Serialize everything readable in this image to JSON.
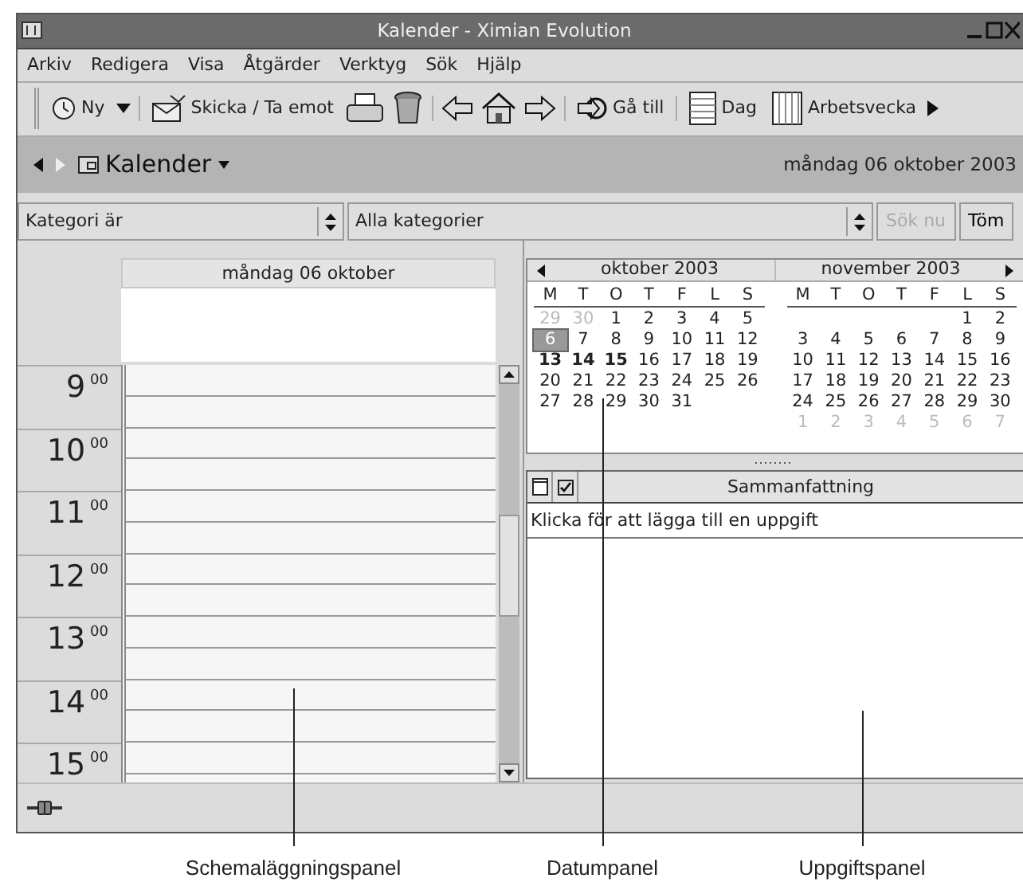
{
  "window": {
    "title": "Kalender - Ximian Evolution"
  },
  "menu": [
    "Arkiv",
    "Redigera",
    "Visa",
    "Åtgärder",
    "Verktyg",
    "Sök",
    "Hjälp"
  ],
  "toolbar": {
    "new": "Ny",
    "send_receive": "Skicka / Ta emot",
    "go_to": "Gå till",
    "day": "Dag",
    "work_week": "Arbetsvecka"
  },
  "folder_bar": {
    "title": "Kalender",
    "date": "måndag 06 oktober 2003"
  },
  "filter": {
    "field": "Kategori är",
    "value": "Alla kategorier",
    "buttons": [
      {
        "label": "Sök nu",
        "disabled": true
      },
      {
        "label": "Töm",
        "disabled": false
      }
    ]
  },
  "day_view": {
    "header": "måndag 06 oktober",
    "hours": [
      {
        "hour": "9",
        "minutes": "00"
      },
      {
        "hour": "10",
        "minutes": "00"
      },
      {
        "hour": "11",
        "minutes": "00"
      },
      {
        "hour": "12",
        "minutes": "00"
      },
      {
        "hour": "13",
        "minutes": "00"
      },
      {
        "hour": "14",
        "minutes": "00"
      },
      {
        "hour": "15",
        "minutes": "00"
      }
    ]
  },
  "date_navigator": {
    "months": [
      {
        "title": "oktober 2003",
        "weekdays": [
          "M",
          "T",
          "O",
          "T",
          "F",
          "L",
          "S"
        ],
        "weeks": [
          [
            {
              "day": "29",
              "selected": false,
              "other_month": true,
              "bold": false
            },
            {
              "day": "30",
              "selected": false,
              "other_month": true,
              "bold": false
            },
            {
              "day": "1",
              "selected": false,
              "other_month": false,
              "bold": false
            },
            {
              "day": "2",
              "selected": false,
              "other_month": false,
              "bold": false
            },
            {
              "day": "3",
              "selected": false,
              "other_month": false,
              "bold": false
            },
            {
              "day": "4",
              "selected": false,
              "other_month": false,
              "bold": false
            },
            {
              "day": "5",
              "selected": false,
              "other_month": false,
              "bold": false
            }
          ],
          [
            {
              "day": "6",
              "selected": true,
              "other_month": false,
              "bold": false
            },
            {
              "day": "7",
              "selected": false,
              "other_month": false,
              "bold": false
            },
            {
              "day": "8",
              "selected": false,
              "other_month": false,
              "bold": false
            },
            {
              "day": "9",
              "selected": false,
              "other_month": false,
              "bold": false
            },
            {
              "day": "10",
              "selected": false,
              "other_month": false,
              "bold": false
            },
            {
              "day": "11",
              "selected": false,
              "other_month": false,
              "bold": false
            },
            {
              "day": "12",
              "selected": false,
              "other_month": false,
              "bold": false
            }
          ],
          [
            {
              "day": "13",
              "selected": false,
              "other_month": false,
              "bold": true
            },
            {
              "day": "14",
              "selected": false,
              "other_month": false,
              "bold": true
            },
            {
              "day": "15",
              "selected": false,
              "other_month": false,
              "bold": true
            },
            {
              "day": "16",
              "selected": false,
              "other_month": false,
              "bold": false
            },
            {
              "day": "17",
              "selected": false,
              "other_month": false,
              "bold": false
            },
            {
              "day": "18",
              "selected": false,
              "other_month": false,
              "bold": false
            },
            {
              "day": "19",
              "selected": false,
              "other_month": false,
              "bold": false
            }
          ],
          [
            {
              "day": "20",
              "selected": false,
              "other_month": false,
              "bold": false
            },
            {
              "day": "21",
              "selected": false,
              "other_month": false,
              "bold": false
            },
            {
              "day": "22",
              "selected": false,
              "other_month": false,
              "bold": false
            },
            {
              "day": "23",
              "selected": false,
              "other_month": false,
              "bold": false
            },
            {
              "day": "24",
              "selected": false,
              "other_month": false,
              "bold": false
            },
            {
              "day": "25",
              "selected": false,
              "other_month": false,
              "bold": false
            },
            {
              "day": "26",
              "selected": false,
              "other_month": false,
              "bold": false
            }
          ],
          [
            {
              "day": "27",
              "selected": false,
              "other_month": false,
              "bold": false
            },
            {
              "day": "28",
              "selected": false,
              "other_month": false,
              "bold": false
            },
            {
              "day": "29",
              "selected": false,
              "other_month": false,
              "bold": false
            },
            {
              "day": "30",
              "selected": false,
              "other_month": false,
              "bold": false
            },
            {
              "day": "31",
              "selected": false,
              "other_month": false,
              "bold": false
            }
          ]
        ]
      },
      {
        "title": "november 2003",
        "weekdays": [
          "M",
          "T",
          "O",
          "T",
          "F",
          "L",
          "S"
        ],
        "weeks": [
          [
            {
              "day": "1",
              "selected": false,
              "other_month": false,
              "bold": false
            },
            {
              "day": "2",
              "selected": false,
              "other_month": false,
              "bold": false
            }
          ],
          [
            {
              "day": "3",
              "selected": false,
              "other_month": false,
              "bold": false
            },
            {
              "day": "4",
              "selected": false,
              "other_month": false,
              "bold": false
            },
            {
              "day": "5",
              "selected": false,
              "other_month": false,
              "bold": false
            },
            {
              "day": "6",
              "selected": false,
              "other_month": false,
              "bold": false
            },
            {
              "day": "7",
              "selected": false,
              "other_month": false,
              "bold": false
            },
            {
              "day": "8",
              "selected": false,
              "other_month": false,
              "bold": false
            },
            {
              "day": "9",
              "selected": false,
              "other_month": false,
              "bold": false
            }
          ],
          [
            {
              "day": "10",
              "selected": false,
              "other_month": false,
              "bold": false
            },
            {
              "day": "11",
              "selected": false,
              "other_month": false,
              "bold": false
            },
            {
              "day": "12",
              "selected": false,
              "other_month": false,
              "bold": false
            },
            {
              "day": "13",
              "selected": false,
              "other_month": false,
              "bold": false
            },
            {
              "day": "14",
              "selected": false,
              "other_month": false,
              "bold": false
            },
            {
              "day": "15",
              "selected": false,
              "other_month": false,
              "bold": false
            },
            {
              "day": "16",
              "selected": false,
              "other_month": false,
              "bold": false
            }
          ],
          [
            {
              "day": "17",
              "selected": false,
              "other_month": false,
              "bold": false
            },
            {
              "day": "18",
              "selected": false,
              "other_month": false,
              "bold": false
            },
            {
              "day": "19",
              "selected": false,
              "other_month": false,
              "bold": false
            },
            {
              "day": "20",
              "selected": false,
              "other_month": false,
              "bold": false
            },
            {
              "day": "21",
              "selected": false,
              "other_month": false,
              "bold": false
            },
            {
              "day": "22",
              "selected": false,
              "other_month": false,
              "bold": false
            },
            {
              "day": "23",
              "selected": false,
              "other_month": false,
              "bold": false
            }
          ],
          [
            {
              "day": "24",
              "selected": false,
              "other_month": false,
              "bold": false
            },
            {
              "day": "25",
              "selected": false,
              "other_month": false,
              "bold": false
            },
            {
              "day": "26",
              "selected": false,
              "other_month": false,
              "bold": false
            },
            {
              "day": "27",
              "selected": false,
              "other_month": false,
              "bold": false
            },
            {
              "day": "28",
              "selected": false,
              "other_month": false,
              "bold": false
            },
            {
              "day": "29",
              "selected": false,
              "other_month": false,
              "bold": false
            },
            {
              "day": "30",
              "selected": false,
              "other_month": false,
              "bold": false
            }
          ],
          [
            {
              "day": "1",
              "selected": false,
              "other_month": true,
              "bold": false
            },
            {
              "day": "2",
              "selected": false,
              "other_month": true,
              "bold": false
            },
            {
              "day": "3",
              "selected": false,
              "other_month": true,
              "bold": false
            },
            {
              "day": "4",
              "selected": false,
              "other_month": true,
              "bold": false
            },
            {
              "day": "5",
              "selected": false,
              "other_month": true,
              "bold": false
            },
            {
              "day": "6",
              "selected": false,
              "other_month": true,
              "bold": false
            },
            {
              "day": "7",
              "selected": false,
              "other_month": true,
              "bold": false
            }
          ]
        ]
      }
    ]
  },
  "task_list": {
    "columns": [
      "Sammanfattning"
    ],
    "new_task_hint": "Klicka för att lägga till en uppgift"
  },
  "callouts": [
    "Schemaläggningspanel",
    "Datumpanel",
    "Uppgiftspanel"
  ]
}
